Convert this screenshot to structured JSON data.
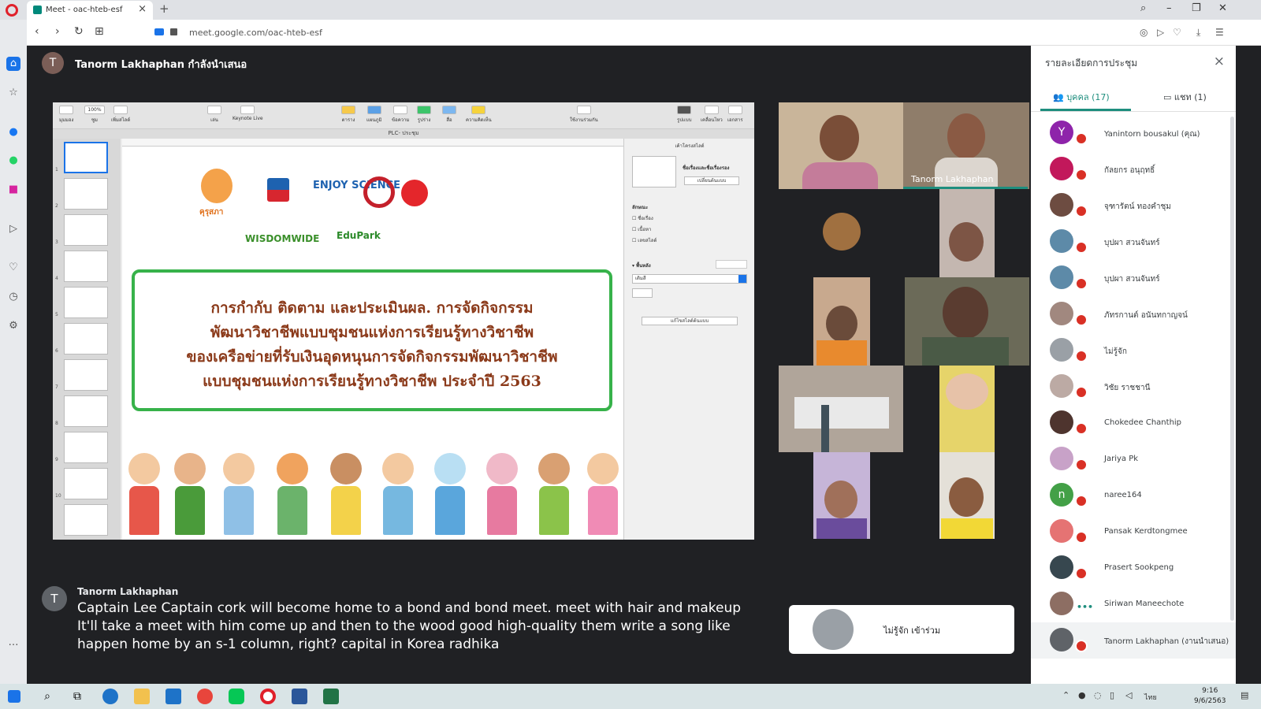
{
  "browser": {
    "tab_title": "Meet - oac-hteb-esf",
    "tab_close": "×",
    "new_tab": "+",
    "url": "meet.google.com/oac-hteb-esf",
    "nav_back": "‹",
    "nav_forward": "›",
    "nav_reload": "↻",
    "nav_grid": "⊞",
    "win_search": "⌕",
    "win_minimize": "–",
    "win_restore": "❐",
    "win_close": "✕"
  },
  "sidebar": {
    "items": [
      "home-icon",
      "news-icon",
      "messenger-icon",
      "whatsapp-icon",
      "instagram-icon",
      "send-icon",
      "heart-icon",
      "history-icon",
      "settings-icon",
      "more-icon"
    ],
    "more": "…"
  },
  "meet": {
    "presenter_initial": "T",
    "presenter_text": "Tanorm Lakhaphan กำลังนำเสนอ",
    "active_speaker_tile_name": "Tanorm Lakhaphan",
    "caption": {
      "initial": "T",
      "speaker": "Tanorm Lakhaphan",
      "lines": [
        "Captain Lee Captain cork will become home to a bond and bond meet. meet with hair and makeup",
        "It'll take a meet with him come up and then to the wood good high-quality them write a song like",
        "happen home by an s-1 column, right? capital in Korea radhika"
      ]
    },
    "unknown_join": "ไม่รู้จัก เข้าร่วม"
  },
  "keynote": {
    "tab_label": "PLC- ประชุม",
    "zoom": "100%",
    "toolbar": [
      "มุมมอง",
      "ซูม",
      "เพิ่มสไลด์",
      "เล่น",
      "Keynote Live",
      "ตาราง",
      "แผนภูมิ",
      "ข้อความ",
      "รูปร่าง",
      "สื่อ",
      "ความคิดเห็น",
      "ใช้งานร่วมกัน",
      "รูปแบบ",
      "เคลื่อนไหว",
      "เอกสาร"
    ],
    "inspector": {
      "header": "เค้าโครงสไลด์",
      "layout_name": "ชื่อเรื่องและชื่อเรื่องรอง",
      "change_master": "เปลี่ยนต้นแบบ",
      "appearance": "ลักษณะ",
      "opt_title": "ชื่อเรื่อง",
      "opt_body": "เนื้อหา",
      "opt_slide_number": "เลขสไลด์",
      "background": "พื้นหลัง",
      "fill": "เติมสี",
      "edit_master": "แก้ไขสไลด์ต้นแบบ"
    },
    "slide": {
      "kurusapa": "คุรุสภา",
      "enjoy": "ENJOY SCIENCE",
      "wisdomwide": "WISDOMWIDE",
      "edupark": "EduPark",
      "title_lines": [
        "การกำกับ ติดตาม และประเมินผล. การจัดกิจกรรม",
        "พัฒนาวิชาชีพแบบชุมชนแห่งการเรียนรู้ทางวิชาชีพ",
        "ของเครือข่ายที่รับเงินอุดหนุนการจัดกิจกรรมพัฒนาวิชาชีพ",
        "แบบชุมชนแห่งการเรียนรู้ทางวิชาชีพ ประจำปี 2563"
      ]
    },
    "thumb_numbers": [
      "1",
      "2",
      "3",
      "4",
      "5",
      "6",
      "7",
      "8",
      "9",
      "10"
    ]
  },
  "panel": {
    "title": "รายละเอียดการประชุม",
    "close": "×",
    "tab_people": "บุคคล (17)",
    "tab_chat": "แชท (1)",
    "participants": [
      {
        "name": "Yanintorn bousakul (คุณ)",
        "initial": "Y",
        "color": "#8e24aa"
      },
      {
        "name": "กัลยกร อนุฤทธิ์",
        "initial": "",
        "color": "#c2185b"
      },
      {
        "name": "จุฑารัตน์ ทองคำชุม",
        "initial": "",
        "color": "#6d4c41"
      },
      {
        "name": "บุปผา สวนจันทร์",
        "initial": "",
        "color": "#5d8aa8"
      },
      {
        "name": "บุปผา สวนจันทร์",
        "initial": "",
        "color": "#5d8aa8"
      },
      {
        "name": "ภัทรกานต์ อนันทกาญจน์",
        "initial": "",
        "color": "#a1887f"
      },
      {
        "name": "ไม่รู้จัก",
        "initial": "",
        "color": "#9aa0a6"
      },
      {
        "name": "วิชัย ราชชานี",
        "initial": "",
        "color": "#bcaaa4"
      },
      {
        "name": "Chokedee Chanthip",
        "initial": "",
        "color": "#4e342e"
      },
      {
        "name": "Jariya Pk",
        "initial": "",
        "color": "#c8a2c8"
      },
      {
        "name": "naree164",
        "initial": "n",
        "color": "#43a047"
      },
      {
        "name": "Pansak Kerdtongmee",
        "initial": "",
        "color": "#e57373"
      },
      {
        "name": "Prasert Sookpeng",
        "initial": "",
        "color": "#37474f"
      },
      {
        "name": "Siriwan Maneechote",
        "initial": "",
        "color": "#8d6e63"
      },
      {
        "name": "Tanorm Lakhaphan (งานนำเสนอ)",
        "initial": "",
        "color": "#5f6368"
      }
    ],
    "dots": "•••"
  },
  "taskbar": {
    "time": "9:16",
    "date": "9/6/2563",
    "lang": "ไทย"
  },
  "colors": {
    "accent": "#1e8e7e",
    "mic_off": "#d93025",
    "slide_title": "#8b3a1a",
    "slide_border": "#37b24a"
  }
}
